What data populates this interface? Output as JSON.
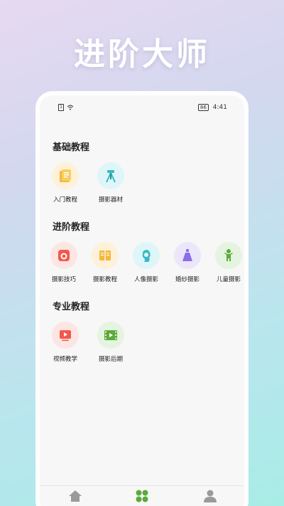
{
  "hero": {
    "title": "进阶大师"
  },
  "status_bar": {
    "time": "4:41",
    "battery": "86"
  },
  "sections": [
    {
      "title": "基础教程",
      "items": [
        {
          "label": "入门教程"
        },
        {
          "label": "摄影器材"
        }
      ]
    },
    {
      "title": "进阶教程",
      "items": [
        {
          "label": "摄影技巧"
        },
        {
          "label": "摄影教程"
        },
        {
          "label": "人像摄影"
        },
        {
          "label": "婚纱摄影"
        },
        {
          "label": "儿童摄影"
        }
      ]
    },
    {
      "title": "专业教程",
      "items": [
        {
          "label": "视频教学"
        },
        {
          "label": "摄影后期"
        }
      ]
    }
  ],
  "tabs": [
    {
      "label": "首页",
      "active": false
    },
    {
      "label": "发现",
      "active": true
    },
    {
      "label": "我的",
      "active": false
    }
  ],
  "colors": {
    "accent": "#5bab3a",
    "inactive": "#9a9a9a"
  }
}
